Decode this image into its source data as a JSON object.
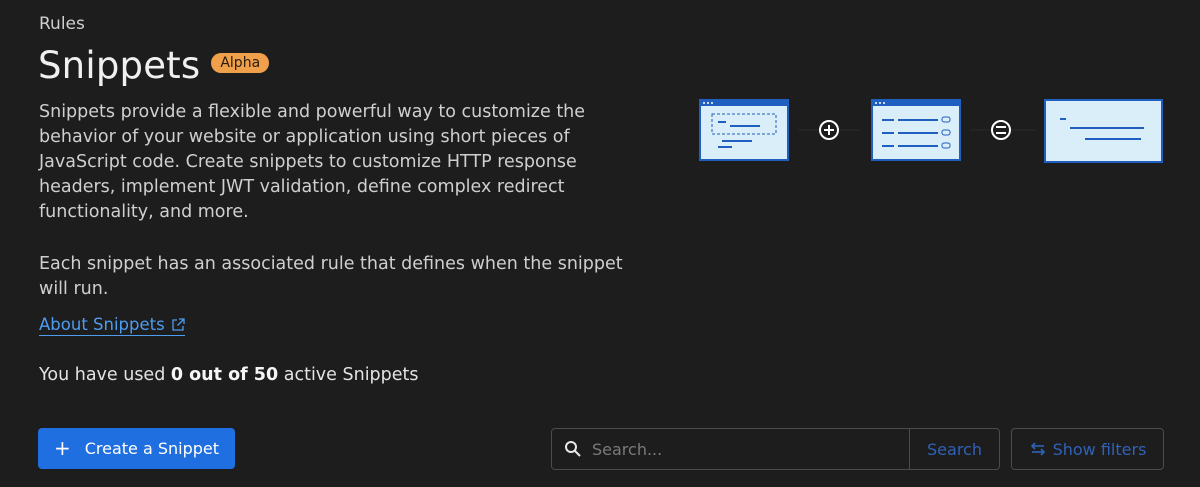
{
  "breadcrumb": "Rules",
  "page": {
    "title": "Snippets",
    "badge": "Alpha",
    "description_1": "Snippets provide a flexible and powerful way to customize the behavior of your website or application using short pieces of JavaScript code. Create snippets to customize HTTP response headers, implement JWT validation, define complex redirect functionality, and more.",
    "description_2": "Each snippet has an associated rule that defines when the snippet will run.",
    "about_link": "About Snippets"
  },
  "usage": {
    "prefix": "You have used ",
    "count": "0 out of 50",
    "suffix": " active Snippets"
  },
  "actions": {
    "create_label": "Create a Snippet",
    "search_placeholder": "Search...",
    "search_button": "Search",
    "filters_button": "Show filters"
  },
  "icons": [
    "external-link-icon",
    "plus-icon",
    "search-icon",
    "swap-arrows-icon",
    "plus-circle-icon",
    "equals-circle-icon"
  ],
  "colors": {
    "accent": "#1f6fe0",
    "badge": "#f0a04a",
    "link": "#4d9cf0",
    "background": "#1d1d1d"
  }
}
